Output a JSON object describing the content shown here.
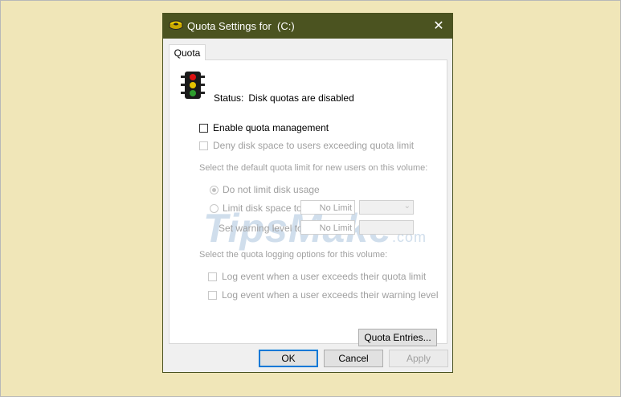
{
  "dialog": {
    "title": "Quota Settings for  (C:)",
    "close_label": "✕"
  },
  "tab": {
    "label": "Quota"
  },
  "status": {
    "label": "Status:",
    "value": "Disk quotas are disabled"
  },
  "options": {
    "enable_quota": "Enable quota management",
    "deny_space": "Deny disk space to users exceeding quota limit",
    "default_limit_heading": "Select the default quota limit for new users on this volume:",
    "no_limit_radio": "Do not limit disk usage",
    "limit_radio": "Limit disk space to",
    "limit_value": "No Limit",
    "warning_label": "Set warning level to",
    "warning_value": "No Limit",
    "logging_heading": "Select the quota logging options for this volume:",
    "log_limit": "Log event when a user exceeds their quota limit",
    "log_warning": "Log event when a user exceeds their warning level"
  },
  "watermark": {
    "main": "TipsMake",
    "suffix": ".com"
  },
  "buttons": {
    "quota_entries": "Quota Entries...",
    "ok": "OK",
    "cancel": "Cancel",
    "apply": "Apply"
  },
  "colors": {
    "titlebar": "#4b5320",
    "background": "#f0e6b8",
    "disabled_text": "#a0a0a0"
  }
}
